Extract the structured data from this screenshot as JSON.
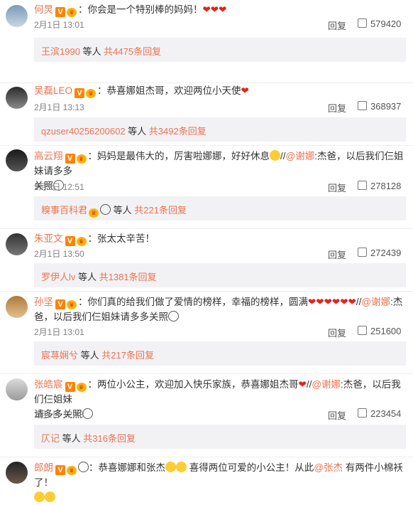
{
  "comments": [
    {
      "user": "何炅",
      "text": "：你会是一个特别棒的妈妈！",
      "hearts": "❤❤❤",
      "time": "2月1日 13:01",
      "reply": "回复",
      "likes": "579420",
      "sub_user": "王滨1990",
      "sub_mid": " 等人 ",
      "sub_count": "共4475条回复"
    },
    {
      "user": "吴磊LEO",
      "text": "：恭喜娜姐杰哥，欢迎两位小天使",
      "hearts": "❤",
      "time": "2月1日 13:13",
      "reply": "回复",
      "likes": "368937",
      "sub_user": "qzuser40256200602",
      "sub_mid": " 等人 ",
      "sub_count": "共3492条回复"
    },
    {
      "user": "高云翔",
      "text1": "：妈妈是最伟大的，厉害啦娜娜，好好休息",
      "text2": "//",
      "mention": "@谢娜",
      "text3": ":杰爸，以后我们仨姐妹请多多",
      "line2": "关照",
      "time": "2月1日 12:51",
      "reply": "回复",
      "likes": "278128",
      "sub_user": "糗事百科君",
      "sub_mid": " 等人 ",
      "sub_count": "共221条回复"
    },
    {
      "user": "朱亚文",
      "text": "：张太太辛苦！",
      "time": "2月1日 13:50",
      "reply": "回复",
      "likes": "272439",
      "sub_user": "罗伊人lv",
      "sub_mid": " 等人 ",
      "sub_count": "共1381条回复"
    },
    {
      "user": "孙坚",
      "text1": "：你们真的给我们做了爱情的榜样，幸福的榜样，圆满",
      "hearts": "❤❤❤❤❤❤",
      "text2": "//",
      "mention": "@谢娜",
      "text3": ":杰",
      "line2": "爸，以后我们仨姐妹请多多关照",
      "time": "2月1日 13:01",
      "reply": "回复",
      "likes": "251600",
      "sub_user": "宸荨娴兮",
      "sub_mid": " 等人 ",
      "sub_count": "共217条回复"
    },
    {
      "user": "张皓宸",
      "text1": "：两位小公主，欢迎加入快乐家族，恭喜娜姐杰哥",
      "hearts": "❤",
      "text2": "//",
      "mention": "@谢娜",
      "text3": ":杰爸，以后我们仨姐妹",
      "line2": "请多多关照",
      "time": "2月1日 12:48",
      "reply": "回复",
      "likes": "223454",
      "sub_user": "仄记",
      "sub_mid": " 等人 ",
      "sub_count": "共316条回复"
    },
    {
      "user": "郎朗",
      "text1": "：恭喜娜娜和张杰",
      "text2": " 喜得两位可爱的小公主！从此",
      "mention": "@张杰",
      "text3": " 有两件小棉袄了！"
    }
  ]
}
